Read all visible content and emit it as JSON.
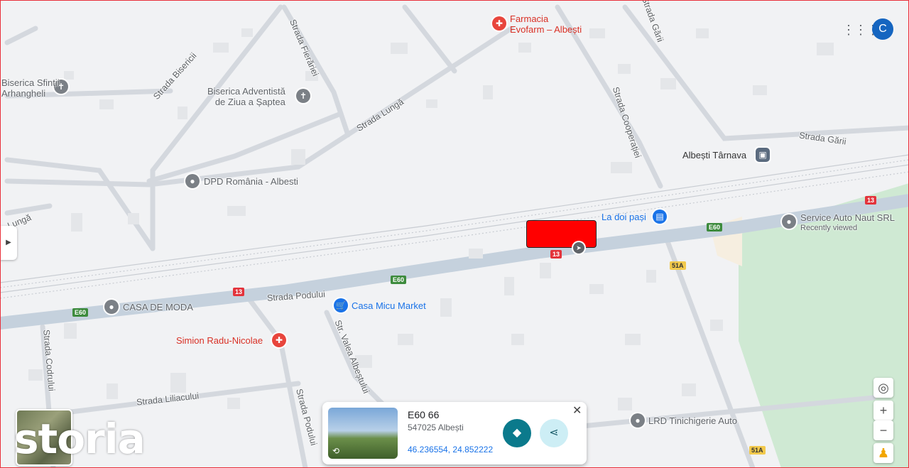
{
  "roads": {
    "strada_fierarie": "Strada Fierăriei",
    "strada_bisericii": "Strada Bisericii",
    "strada_lunga_top": "Strada Lungă",
    "strada_lunga_left": "Lungă",
    "strada_cooperatiei": "Strada Cooperației",
    "strada_garii_top": "Strada Gării",
    "strada_garii_right": "Strada Gării",
    "strada_podului": "Strada Podului",
    "strada_podului_v": "Strada Podului",
    "str_valea": "Str. Valea Albeștului",
    "strada_codrului": "Strada Codrului",
    "strada_liliacului": "Strada Liliacului"
  },
  "shields": {
    "e60_a": "E60",
    "e60_b": "E60",
    "e60_c": "E60",
    "n13_a": "13",
    "n13_b": "13",
    "n13_c": "13",
    "n51a_a": "51A",
    "n51a_b": "51A"
  },
  "places": {
    "farmacia": "Farmacia\nEvofarm – Albești",
    "biserica_sfintii": "Biserica Sfinții\nArhangheli",
    "biserica_adventista": "Biserica Adventistă\nde Ziua a Șaptea",
    "dpd": "DPD România - Albesti",
    "albesti_tarnava": "Albești Târnava",
    "la_doi_pasi": "La doi pași",
    "service_auto": "Service Auto Naut SRL",
    "recently_viewed": "Recently viewed",
    "casa_de_moda": "CASA DE MODA",
    "casa_micu": "Casa Micu Market",
    "simion": "Simion Radu-Nicolae",
    "lrd": "LRD Tinichigerie Auto"
  },
  "card": {
    "title": "E60 66",
    "subtitle": "547025 Albești",
    "coords": "46.236554, 24.852222"
  },
  "header": {
    "avatar_letter": "C"
  },
  "logo_text": "storia",
  "colors": {
    "accent": "#1a73e8",
    "direction": "#0b7a8c",
    "marker_red": "#ff0000",
    "park": "#cfe9d3"
  }
}
